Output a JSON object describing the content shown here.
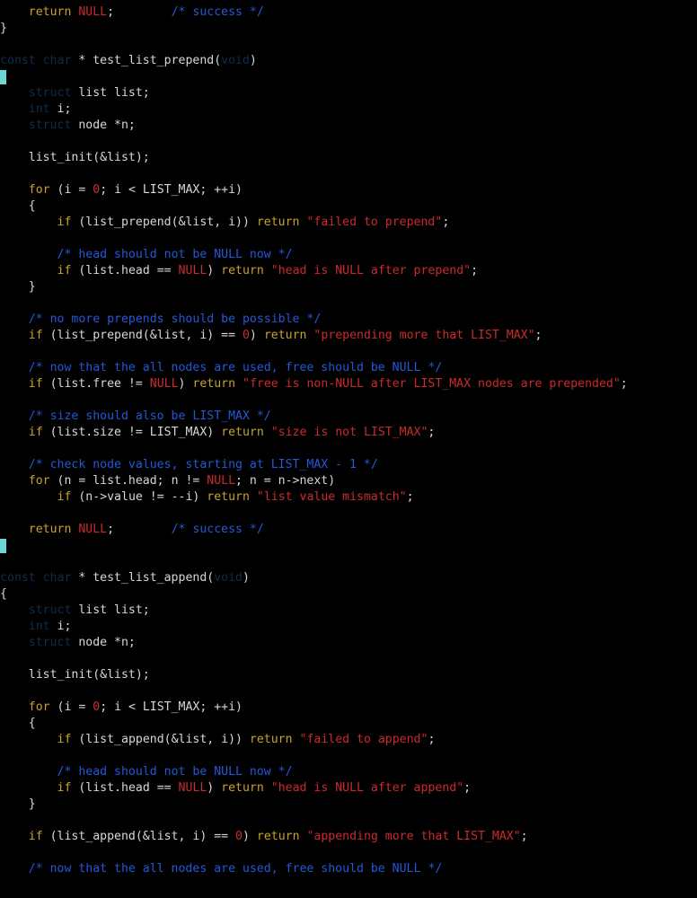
{
  "colors": {
    "background": "#000000",
    "plain": "#d7d7d7",
    "keyword": "#c9a227",
    "type": "#0f2d4d",
    "string": "#cc2a2a",
    "number": "#cc2a2a",
    "null": "#cc2a2a",
    "comment": "#2358d6",
    "cursor": "#6dd6d6"
  },
  "editor": {
    "lines": [
      {
        "cursor": false,
        "tokens": [
          [
            "pl",
            "    "
          ],
          [
            "kw",
            "return"
          ],
          [
            "pl",
            " "
          ],
          [
            "null",
            "NULL"
          ],
          [
            "pl",
            ";        "
          ],
          [
            "cm",
            "/* success */"
          ]
        ]
      },
      {
        "cursor": false,
        "tokens": [
          [
            "pl",
            "}"
          ]
        ]
      },
      {
        "cursor": false,
        "tokens": []
      },
      {
        "cursor": false,
        "tokens": [
          [
            "ty",
            "const char"
          ],
          [
            "pl",
            " * test_list_prepend("
          ],
          [
            "ty",
            "void"
          ],
          [
            "pl",
            ")"
          ]
        ]
      },
      {
        "cursor": true,
        "tokens": []
      },
      {
        "cursor": false,
        "tokens": [
          [
            "pl",
            "    "
          ],
          [
            "ty",
            "struct"
          ],
          [
            "pl",
            " list list;"
          ]
        ]
      },
      {
        "cursor": false,
        "tokens": [
          [
            "pl",
            "    "
          ],
          [
            "ty",
            "int"
          ],
          [
            "pl",
            " i;"
          ]
        ]
      },
      {
        "cursor": false,
        "tokens": [
          [
            "pl",
            "    "
          ],
          [
            "ty",
            "struct"
          ],
          [
            "pl",
            " node *n;"
          ]
        ]
      },
      {
        "cursor": false,
        "tokens": []
      },
      {
        "cursor": false,
        "tokens": [
          [
            "pl",
            "    list_init(&list);"
          ]
        ]
      },
      {
        "cursor": false,
        "tokens": []
      },
      {
        "cursor": false,
        "tokens": [
          [
            "pl",
            "    "
          ],
          [
            "kw",
            "for"
          ],
          [
            "pl",
            " (i = "
          ],
          [
            "num",
            "0"
          ],
          [
            "pl",
            "; i < LIST_MAX; ++i)"
          ]
        ]
      },
      {
        "cursor": false,
        "tokens": [
          [
            "pl",
            "    {"
          ]
        ]
      },
      {
        "cursor": false,
        "tokens": [
          [
            "pl",
            "        "
          ],
          [
            "kw",
            "if"
          ],
          [
            "pl",
            " (list_prepend(&list, i)) "
          ],
          [
            "kw",
            "return"
          ],
          [
            "pl",
            " "
          ],
          [
            "str",
            "\"failed to prepend\""
          ],
          [
            "pl",
            ";"
          ]
        ]
      },
      {
        "cursor": false,
        "tokens": []
      },
      {
        "cursor": false,
        "tokens": [
          [
            "pl",
            "        "
          ],
          [
            "cm",
            "/* head should not be NULL now */"
          ]
        ]
      },
      {
        "cursor": false,
        "tokens": [
          [
            "pl",
            "        "
          ],
          [
            "kw",
            "if"
          ],
          [
            "pl",
            " (list.head == "
          ],
          [
            "null",
            "NULL"
          ],
          [
            "pl",
            ") "
          ],
          [
            "kw",
            "return"
          ],
          [
            "pl",
            " "
          ],
          [
            "str",
            "\"head is NULL after prepend\""
          ],
          [
            "pl",
            ";"
          ]
        ]
      },
      {
        "cursor": false,
        "tokens": [
          [
            "pl",
            "    }"
          ]
        ]
      },
      {
        "cursor": false,
        "tokens": []
      },
      {
        "cursor": false,
        "tokens": [
          [
            "pl",
            "    "
          ],
          [
            "cm",
            "/* no more prepends should be possible */"
          ]
        ]
      },
      {
        "cursor": false,
        "tokens": [
          [
            "pl",
            "    "
          ],
          [
            "kw",
            "if"
          ],
          [
            "pl",
            " (list_prepend(&list, i) == "
          ],
          [
            "num",
            "0"
          ],
          [
            "pl",
            ") "
          ],
          [
            "kw",
            "return"
          ],
          [
            "pl",
            " "
          ],
          [
            "str",
            "\"prepending more that LIST_MAX\""
          ],
          [
            "pl",
            ";"
          ]
        ]
      },
      {
        "cursor": false,
        "tokens": []
      },
      {
        "cursor": false,
        "tokens": [
          [
            "pl",
            "    "
          ],
          [
            "cm",
            "/* now that the all nodes are used, free should be NULL */"
          ]
        ]
      },
      {
        "cursor": false,
        "tokens": [
          [
            "pl",
            "    "
          ],
          [
            "kw",
            "if"
          ],
          [
            "pl",
            " (list.free != "
          ],
          [
            "null",
            "NULL"
          ],
          [
            "pl",
            ") "
          ],
          [
            "kw",
            "return"
          ],
          [
            "pl",
            " "
          ],
          [
            "str",
            "\"free is non-NULL after LIST_MAX nodes are prepended\""
          ],
          [
            "pl",
            ";"
          ]
        ]
      },
      {
        "cursor": false,
        "tokens": []
      },
      {
        "cursor": false,
        "tokens": [
          [
            "pl",
            "    "
          ],
          [
            "cm",
            "/* size should also be LIST_MAX */"
          ]
        ]
      },
      {
        "cursor": false,
        "tokens": [
          [
            "pl",
            "    "
          ],
          [
            "kw",
            "if"
          ],
          [
            "pl",
            " (list.size != LIST_MAX) "
          ],
          [
            "kw",
            "return"
          ],
          [
            "pl",
            " "
          ],
          [
            "str",
            "\"size is not LIST_MAX\""
          ],
          [
            "pl",
            ";"
          ]
        ]
      },
      {
        "cursor": false,
        "tokens": []
      },
      {
        "cursor": false,
        "tokens": [
          [
            "pl",
            "    "
          ],
          [
            "cm",
            "/* check node values, starting at LIST_MAX - 1 */"
          ]
        ]
      },
      {
        "cursor": false,
        "tokens": [
          [
            "pl",
            "    "
          ],
          [
            "kw",
            "for"
          ],
          [
            "pl",
            " (n = list.head; n != "
          ],
          [
            "null",
            "NULL"
          ],
          [
            "pl",
            "; n = n->next)"
          ]
        ]
      },
      {
        "cursor": false,
        "tokens": [
          [
            "pl",
            "        "
          ],
          [
            "kw",
            "if"
          ],
          [
            "pl",
            " (n->value != --i) "
          ],
          [
            "kw",
            "return"
          ],
          [
            "pl",
            " "
          ],
          [
            "str",
            "\"list value mismatch\""
          ],
          [
            "pl",
            ";"
          ]
        ]
      },
      {
        "cursor": false,
        "tokens": []
      },
      {
        "cursor": false,
        "tokens": [
          [
            "pl",
            "    "
          ],
          [
            "kw",
            "return"
          ],
          [
            "pl",
            " "
          ],
          [
            "null",
            "NULL"
          ],
          [
            "pl",
            ";        "
          ],
          [
            "cm",
            "/* success */"
          ]
        ]
      },
      {
        "cursor": true,
        "tokens": []
      },
      {
        "cursor": false,
        "tokens": []
      },
      {
        "cursor": false,
        "tokens": [
          [
            "ty",
            "const char"
          ],
          [
            "pl",
            " * test_list_append("
          ],
          [
            "ty",
            "void"
          ],
          [
            "pl",
            ")"
          ]
        ]
      },
      {
        "cursor": false,
        "tokens": [
          [
            "pl",
            "{"
          ]
        ]
      },
      {
        "cursor": false,
        "tokens": [
          [
            "pl",
            "    "
          ],
          [
            "ty",
            "struct"
          ],
          [
            "pl",
            " list list;"
          ]
        ]
      },
      {
        "cursor": false,
        "tokens": [
          [
            "pl",
            "    "
          ],
          [
            "ty",
            "int"
          ],
          [
            "pl",
            " i;"
          ]
        ]
      },
      {
        "cursor": false,
        "tokens": [
          [
            "pl",
            "    "
          ],
          [
            "ty",
            "struct"
          ],
          [
            "pl",
            " node *n;"
          ]
        ]
      },
      {
        "cursor": false,
        "tokens": []
      },
      {
        "cursor": false,
        "tokens": [
          [
            "pl",
            "    list_init(&list);"
          ]
        ]
      },
      {
        "cursor": false,
        "tokens": []
      },
      {
        "cursor": false,
        "tokens": [
          [
            "pl",
            "    "
          ],
          [
            "kw",
            "for"
          ],
          [
            "pl",
            " (i = "
          ],
          [
            "num",
            "0"
          ],
          [
            "pl",
            "; i < LIST_MAX; ++i)"
          ]
        ]
      },
      {
        "cursor": false,
        "tokens": [
          [
            "pl",
            "    {"
          ]
        ]
      },
      {
        "cursor": false,
        "tokens": [
          [
            "pl",
            "        "
          ],
          [
            "kw",
            "if"
          ],
          [
            "pl",
            " (list_append(&list, i)) "
          ],
          [
            "kw",
            "return"
          ],
          [
            "pl",
            " "
          ],
          [
            "str",
            "\"failed to append\""
          ],
          [
            "pl",
            ";"
          ]
        ]
      },
      {
        "cursor": false,
        "tokens": []
      },
      {
        "cursor": false,
        "tokens": [
          [
            "pl",
            "        "
          ],
          [
            "cm",
            "/* head should not be NULL now */"
          ]
        ]
      },
      {
        "cursor": false,
        "tokens": [
          [
            "pl",
            "        "
          ],
          [
            "kw",
            "if"
          ],
          [
            "pl",
            " (list.head == "
          ],
          [
            "null",
            "NULL"
          ],
          [
            "pl",
            ") "
          ],
          [
            "kw",
            "return"
          ],
          [
            "pl",
            " "
          ],
          [
            "str",
            "\"head is NULL after append\""
          ],
          [
            "pl",
            ";"
          ]
        ]
      },
      {
        "cursor": false,
        "tokens": [
          [
            "pl",
            "    }"
          ]
        ]
      },
      {
        "cursor": false,
        "tokens": []
      },
      {
        "cursor": false,
        "tokens": [
          [
            "pl",
            "    "
          ],
          [
            "kw",
            "if"
          ],
          [
            "pl",
            " (list_append(&list, i) == "
          ],
          [
            "num",
            "0"
          ],
          [
            "pl",
            ") "
          ],
          [
            "kw",
            "return"
          ],
          [
            "pl",
            " "
          ],
          [
            "str",
            "\"appending more that LIST_MAX\""
          ],
          [
            "pl",
            ";"
          ]
        ]
      },
      {
        "cursor": false,
        "tokens": []
      },
      {
        "cursor": false,
        "tokens": [
          [
            "pl",
            "    "
          ],
          [
            "cm",
            "/* now that the all nodes are used, free should be NULL */"
          ]
        ]
      }
    ]
  }
}
